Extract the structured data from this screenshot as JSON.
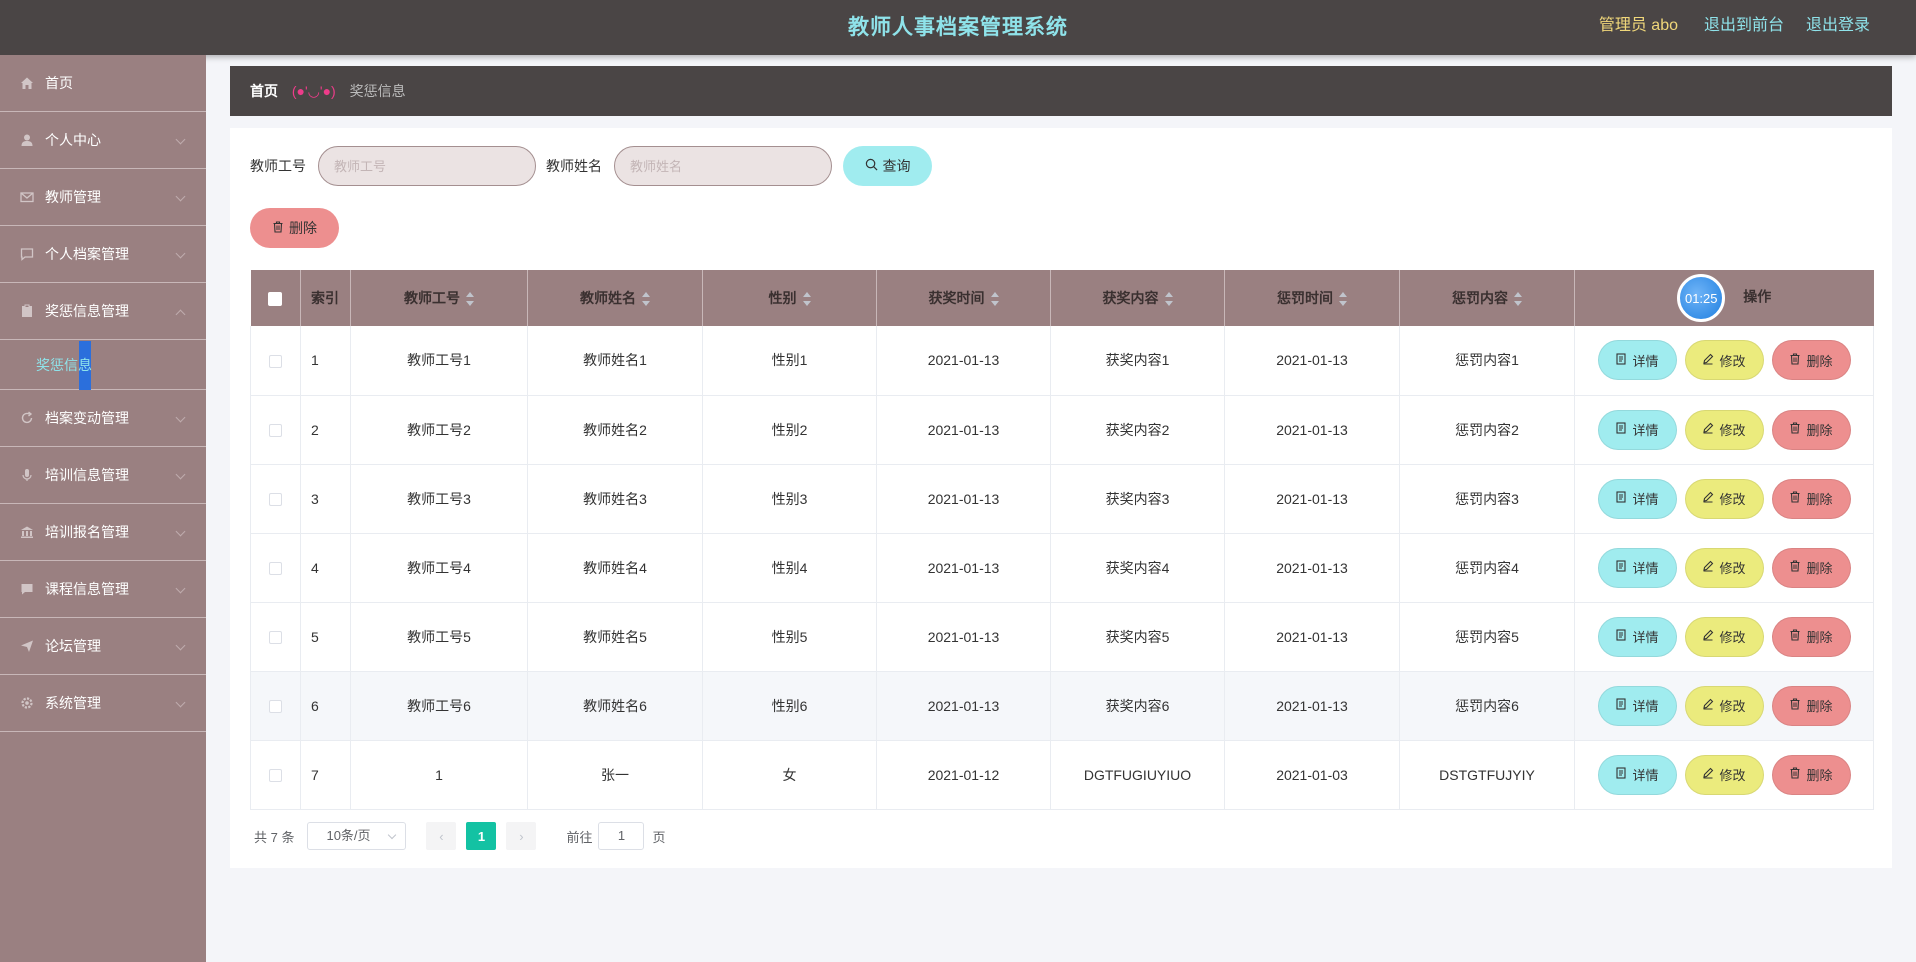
{
  "header": {
    "title": "教师人事档案管理系统",
    "admin": "管理员 abo",
    "front_link": "退出到前台",
    "logout_link": "退出登录"
  },
  "sidebar": {
    "items": [
      {
        "label": "首页",
        "icon": "home-icon"
      },
      {
        "label": "个人中心",
        "icon": "user-icon"
      },
      {
        "label": "教师管理",
        "icon": "mail-icon"
      },
      {
        "label": "个人档案管理",
        "icon": "chat-icon"
      },
      {
        "label": "奖惩信息管理",
        "icon": "clipboard-icon"
      },
      {
        "label": "档案变动管理",
        "icon": "refresh-icon"
      },
      {
        "label": "培训信息管理",
        "icon": "mic-icon"
      },
      {
        "label": "培训报名管理",
        "icon": "bank-icon"
      },
      {
        "label": "课程信息管理",
        "icon": "message-icon"
      },
      {
        "label": "论坛管理",
        "icon": "send-icon"
      },
      {
        "label": "系统管理",
        "icon": "settings-icon"
      }
    ],
    "active_sub": "奖惩信息"
  },
  "breadcrumb": {
    "home": "首页",
    "emoticon": "(●'◡'●)",
    "current": "奖惩信息"
  },
  "search": {
    "teacher_no_label": "教师工号",
    "teacher_no_placeholder": "教师工号",
    "teacher_no_value": "",
    "teacher_name_label": "教师姓名",
    "teacher_name_placeholder": "教师姓名",
    "teacher_name_value": "",
    "query_label": "查询"
  },
  "toolbar": {
    "delete_label": "删除"
  },
  "table": {
    "columns": [
      "索引",
      "教师工号",
      "教师姓名",
      "性别",
      "获奖时间",
      "获奖内容",
      "惩罚时间",
      "惩罚内容",
      "操作"
    ],
    "timer": "01:25",
    "rows": [
      [
        "1",
        "教师工号1",
        "教师姓名1",
        "性别1",
        "2021-01-13",
        "获奖内容1",
        "2021-01-13",
        "惩罚内容1"
      ],
      [
        "2",
        "教师工号2",
        "教师姓名2",
        "性别2",
        "2021-01-13",
        "获奖内容2",
        "2021-01-13",
        "惩罚内容2"
      ],
      [
        "3",
        "教师工号3",
        "教师姓名3",
        "性别3",
        "2021-01-13",
        "获奖内容3",
        "2021-01-13",
        "惩罚内容3"
      ],
      [
        "4",
        "教师工号4",
        "教师姓名4",
        "性别4",
        "2021-01-13",
        "获奖内容4",
        "2021-01-13",
        "惩罚内容4"
      ],
      [
        "5",
        "教师工号5",
        "教师姓名5",
        "性别5",
        "2021-01-13",
        "获奖内容5",
        "2021-01-13",
        "惩罚内容5"
      ],
      [
        "6",
        "教师工号6",
        "教师姓名6",
        "性别6",
        "2021-01-13",
        "获奖内容6",
        "2021-01-13",
        "惩罚内容6"
      ],
      [
        "7",
        "1",
        "张一",
        "女",
        "2021-01-12",
        "DGTFUGIUYIUO",
        "2021-01-03",
        "DSTGTFUJYIY"
      ]
    ],
    "highlight_row": 5,
    "actions": {
      "detail": "详情",
      "edit": "修改",
      "delete": "删除"
    }
  },
  "pagination": {
    "total": "共 7 条",
    "page_size": "10条/页",
    "current_page": "1",
    "goto_label": "前往",
    "goto_value": "1",
    "page_suffix": "页"
  },
  "colors": {
    "header_bg": "#4a4545",
    "sidebar_bg": "#9a8081",
    "accent_cyan": "#8fe3ea",
    "detail_btn": "#a0ecef",
    "edit_btn": "#ebeb7d",
    "delete_btn": "#ed8f8f",
    "page_active": "#13c2a3"
  }
}
